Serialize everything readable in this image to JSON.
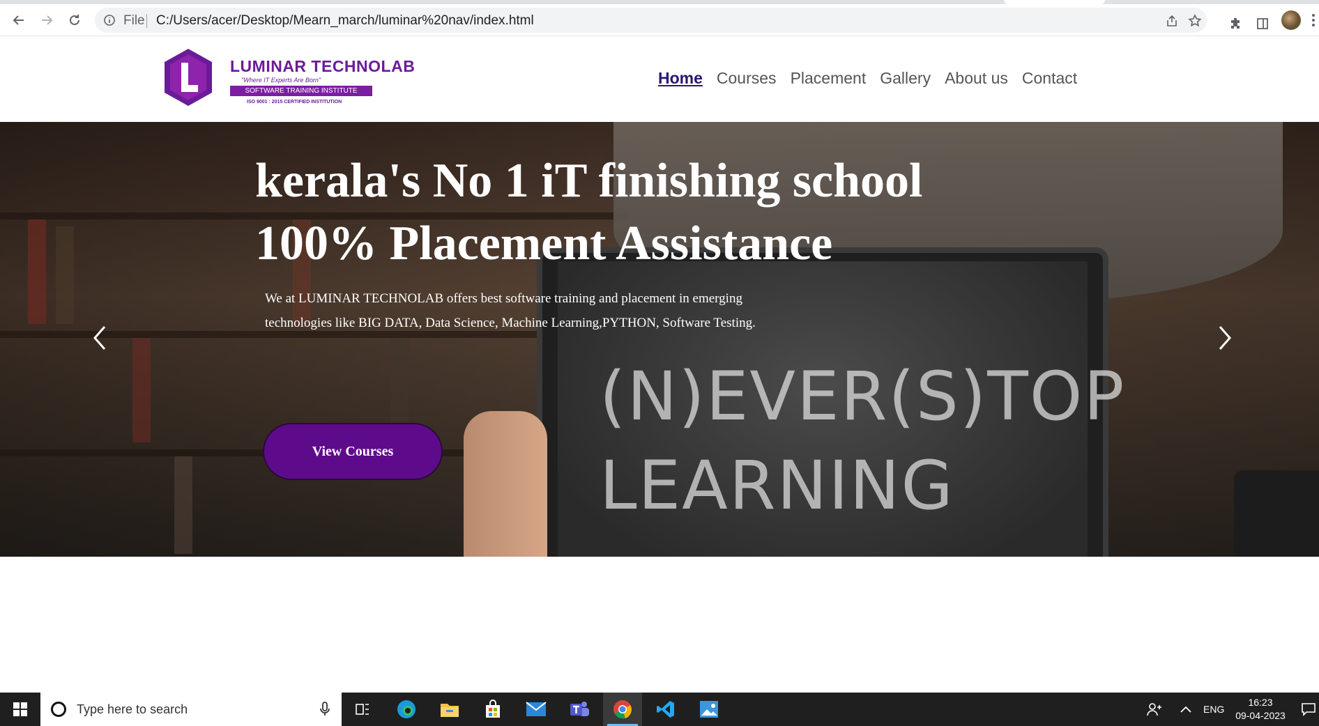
{
  "browser": {
    "back_label": "Back",
    "forward_label": "Forward",
    "reload_label": "Reload",
    "scheme_label": "File",
    "url": "C:/Users/acer/Desktop/Mearn_march/luminar%20nav/index.html"
  },
  "site": {
    "logo": {
      "name": "LUMINAR TECHNOLAB",
      "tagline": "\"Where IT Experts Are Born\"",
      "bar_text": "SOFTWARE TRAINING INSTITUTE",
      "iso_text": "ISO 9001 : 2015 CERTIFIED INSTITUTION",
      "brand_color": "#6a1b9a"
    },
    "nav": {
      "items": [
        {
          "label": "Home",
          "active": true
        },
        {
          "label": "Courses",
          "active": false
        },
        {
          "label": "Placement",
          "active": false
        },
        {
          "label": "Gallery",
          "active": false
        },
        {
          "label": "About us",
          "active": false
        },
        {
          "label": "Contact",
          "active": false
        }
      ]
    },
    "hero": {
      "title_line1": "kerala's No 1 iT finishing school",
      "title_line2": "100% Placement Assistance",
      "description": "We at LUMINAR TECHNOLAB offers best software training and placement in emerging technologies like BIG DATA, Data Science, Machine Learning,PYTHON, Software Testing.",
      "cta_label": "View Courses",
      "cta_color": "#5e0b8b",
      "image_text": "(N)EVER(S)TOP\nLEARNING"
    }
  },
  "taskbar": {
    "search_placeholder": "Type here to search",
    "language": "ENG",
    "time": "16:23",
    "date": "09-04-2023",
    "apps": [
      "task-view",
      "edge",
      "file-explorer",
      "microsoft-store",
      "mail",
      "teams",
      "chrome",
      "vscode",
      "photos"
    ]
  }
}
